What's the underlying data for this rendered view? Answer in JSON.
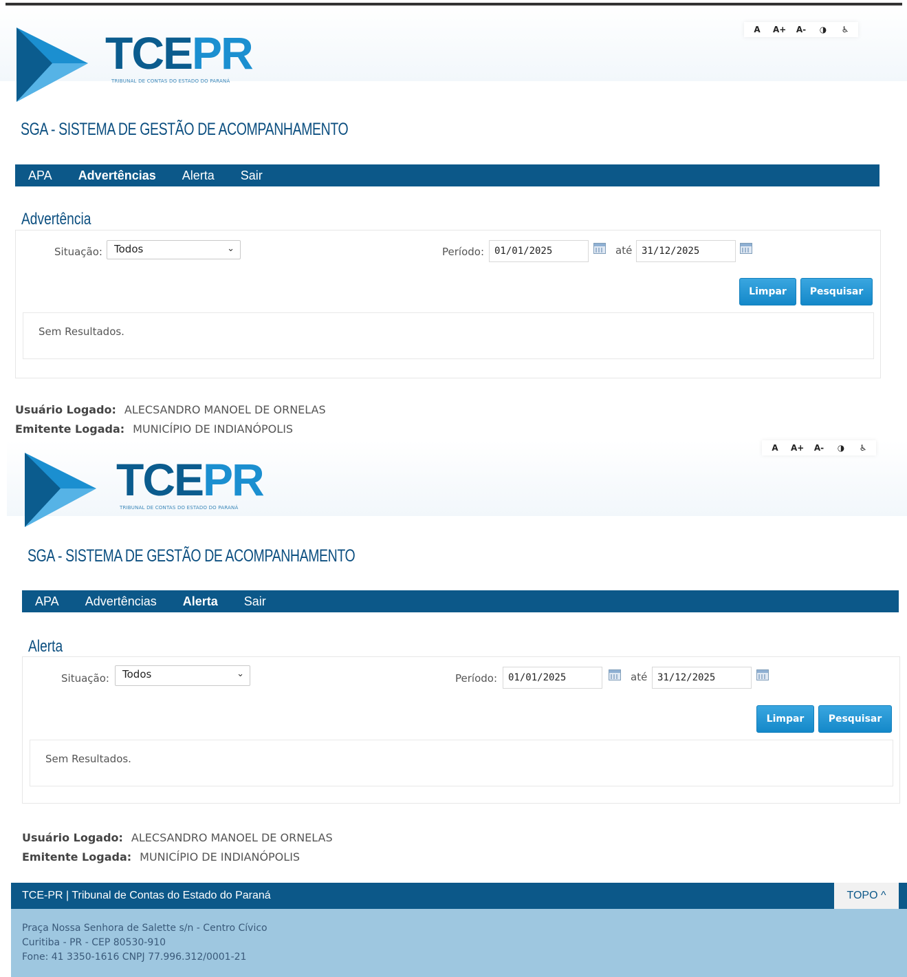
{
  "brand": {
    "tce": "TCE",
    "pr": "PR",
    "sub": "TRIBUNAL DE CONTAS DO ESTADO DO PARANÁ"
  },
  "accessibility": [
    "A",
    "A+",
    "A-",
    "◑",
    "♿"
  ],
  "app_title": "SGA - SISTEMA DE GESTÃO DE ACOMPANHAMENTO",
  "nav": [
    "APA",
    "Advertências",
    "Alerta",
    "Sair"
  ],
  "panels": [
    {
      "active_nav": "Advertências",
      "section_title": "Advertência",
      "situacao_label": "Situação:",
      "situacao_value": "Todos",
      "periodo_label": "Período:",
      "date_from": "01/01/2025",
      "ate_label": "até",
      "date_to": "31/12/2025",
      "btn_clear": "Limpar",
      "btn_search": "Pesquisar",
      "results_text": "Sem Resultados.",
      "user_label": "Usuário Logado:",
      "user_value": "ALECSANDRO MANOEL DE ORNELAS",
      "emitente_label": "Emitente Logada:",
      "emitente_value": "MUNICÍPIO DE INDIANÓPOLIS"
    },
    {
      "active_nav": "Alerta",
      "section_title": "Alerta",
      "situacao_label": "Situação:",
      "situacao_value": "Todos",
      "periodo_label": "Período:",
      "date_from": "01/01/2025",
      "ate_label": "até",
      "date_to": "31/12/2025",
      "btn_clear": "Limpar",
      "btn_search": "Pesquisar",
      "results_text": "Sem Resultados.",
      "user_label": "Usuário Logado:",
      "user_value": "ALECSANDRO MANOEL DE ORNELAS",
      "emitente_label": "Emitente Logada:",
      "emitente_value": "MUNICÍPIO DE INDIANÓPOLIS"
    }
  ],
  "footer": {
    "title": "TCE-PR | Tribunal de Contas do Estado do Paraná",
    "topo": "TOPO ^",
    "address1": "Praça Nossa Senhora de Salette s/n - Centro Cívico",
    "address2": "Curitiba - PR - CEP 80530-910",
    "address3": "Fone: 41 3350-1616  CNPJ 77.996.312/0001-21"
  },
  "colors": {
    "nav_bg": "#0c5889",
    "accent": "#1488c9",
    "footer_body": "#9ec7e0",
    "title": "#0c4f80"
  }
}
